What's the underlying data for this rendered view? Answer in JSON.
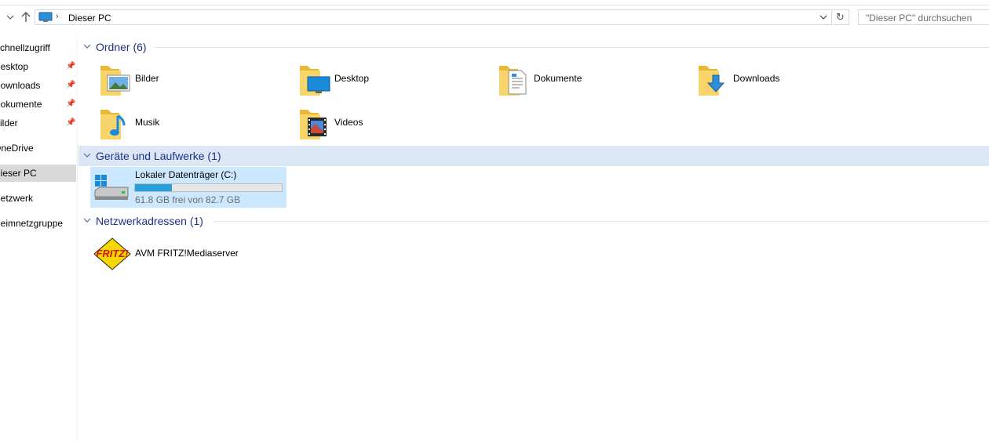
{
  "address": {
    "crumb": "Dieser PC",
    "search_placeholder": "\"Dieser PC\" durchsuchen"
  },
  "sidebar": {
    "items": [
      {
        "label": "Schnellzugriff",
        "pinned": false
      },
      {
        "label": "Desktop",
        "pinned": true
      },
      {
        "label": "Downloads",
        "pinned": true
      },
      {
        "label": "Dokumente",
        "pinned": true
      },
      {
        "label": "Bilder",
        "pinned": true
      },
      {
        "label": "OneDrive",
        "pinned": false
      },
      {
        "label": "Dieser PC",
        "pinned": false,
        "selected": true
      },
      {
        "label": "Netzwerk",
        "pinned": false
      },
      {
        "label": "Heimnetzgruppe",
        "pinned": false
      }
    ]
  },
  "groups": {
    "folders": {
      "title": "Ordner (6)"
    },
    "devices": {
      "title": "Geräte und Laufwerke (1)"
    },
    "network": {
      "title": "Netzwerkadressen (1)"
    }
  },
  "folders": [
    {
      "name": "Bilder",
      "icon": "pictures-folder-icon"
    },
    {
      "name": "Desktop",
      "icon": "desktop-folder-icon"
    },
    {
      "name": "Dokumente",
      "icon": "documents-folder-icon"
    },
    {
      "name": "Downloads",
      "icon": "downloads-folder-icon"
    },
    {
      "name": "Musik",
      "icon": "music-folder-icon"
    },
    {
      "name": "Videos",
      "icon": "videos-folder-icon"
    }
  ],
  "drive": {
    "name": "Lokaler Datenträger (C:)",
    "info": "61.8 GB frei von 82.7 GB",
    "used_fraction": 0.253
  },
  "network_location": {
    "name": "AVM FRITZ!Mediaserver",
    "logo_text": "FRITZ!"
  },
  "colors": {
    "group_title": "#1e3287",
    "selection": "#cce8ff",
    "progress": "#26a0da"
  }
}
